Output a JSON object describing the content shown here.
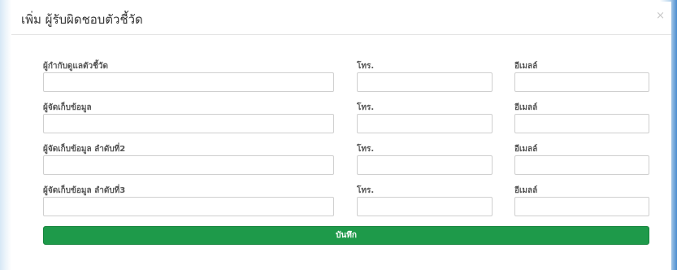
{
  "modal": {
    "title": "เพิ่ม ผู้รับผิดชอบตัวชี้วัด",
    "close_label": "×"
  },
  "rows": [
    {
      "name_label": "ผู้กำกับดูแลตัวชี้วัด",
      "phone_label": "โทร.",
      "email_label": "อีเมลล์",
      "name_value": "",
      "phone_value": "",
      "email_value": ""
    },
    {
      "name_label": "ผู้จัดเก็บข้อมูล",
      "phone_label": "โทร.",
      "email_label": "อีเมลล์",
      "name_value": "",
      "phone_value": "",
      "email_value": ""
    },
    {
      "name_label": "ผู้จัดเก็บข้อมูล ลำดับที่2",
      "phone_label": "โทร.",
      "email_label": "อีเมลล์",
      "name_value": "",
      "phone_value": "",
      "email_value": ""
    },
    {
      "name_label": "ผู้จัดเก็บข้อมูล ลำดับที่3",
      "phone_label": "โทร.",
      "email_label": "อีเมลล์",
      "name_value": "",
      "phone_value": "",
      "email_value": ""
    }
  ],
  "submit_label": "บันทึก",
  "colors": {
    "submit_bg": "#1e9a4a",
    "page_bg": "#3a86c8"
  }
}
